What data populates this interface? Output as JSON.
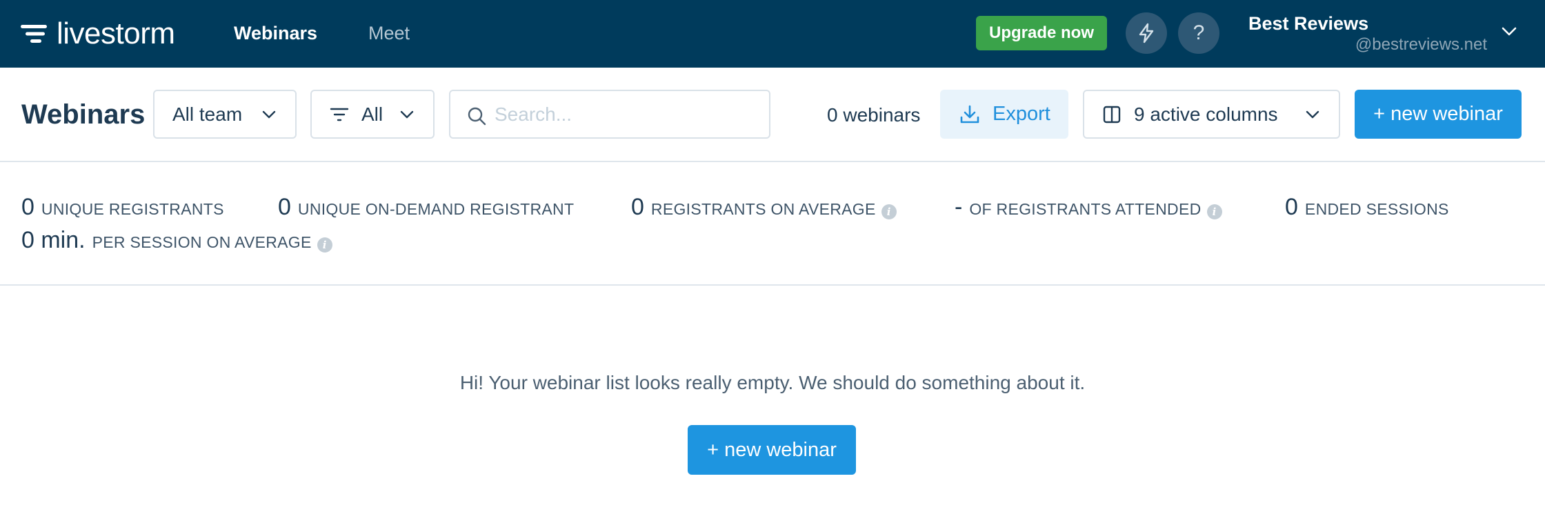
{
  "brand": {
    "logo_text": "livestorm"
  },
  "nav": {
    "items": [
      {
        "label": "Webinars",
        "active": true
      },
      {
        "label": "Meet",
        "active": false
      }
    ]
  },
  "header": {
    "upgrade_label": "Upgrade now",
    "help_label": "?",
    "user": {
      "name": "Best Reviews",
      "handle": "@bestreviews.net"
    }
  },
  "toolbar": {
    "title": "Webinars",
    "team_select": "All team",
    "status_filter": "All",
    "search_placeholder": "Search...",
    "search_value": "",
    "count_label": "0 webinars",
    "export_label": "Export",
    "columns_label": "9 active columns",
    "new_button": "+ new webinar"
  },
  "stats": [
    {
      "value": "0",
      "label": "UNIQUE REGISTRANTS",
      "info": false
    },
    {
      "value": "0",
      "label": "UNIQUE ON-DEMAND REGISTRANT",
      "info": false
    },
    {
      "value": "0",
      "label": "REGISTRANTS ON AVERAGE",
      "info": true
    },
    {
      "value": "-",
      "label": "OF REGISTRANTS ATTENDED",
      "info": true
    },
    {
      "value": "0",
      "label": "ENDED SESSIONS",
      "info": false
    },
    {
      "value": "0 min.",
      "label": "PER SESSION ON AVERAGE",
      "info": true
    }
  ],
  "empty_state": {
    "message": "Hi! Your webinar list looks really empty. We should do something about it.",
    "button": "+ new webinar"
  },
  "colors": {
    "topbar": "#003b5c",
    "upgrade": "#3aa34a",
    "primary": "#1e95e0",
    "export_bg": "#e8f3fb"
  },
  "icons": [
    "logo-icon",
    "bolt-icon",
    "help-icon",
    "chevron-down-icon",
    "filter-icon",
    "search-icon",
    "download-icon",
    "columns-icon",
    "info-icon"
  ]
}
